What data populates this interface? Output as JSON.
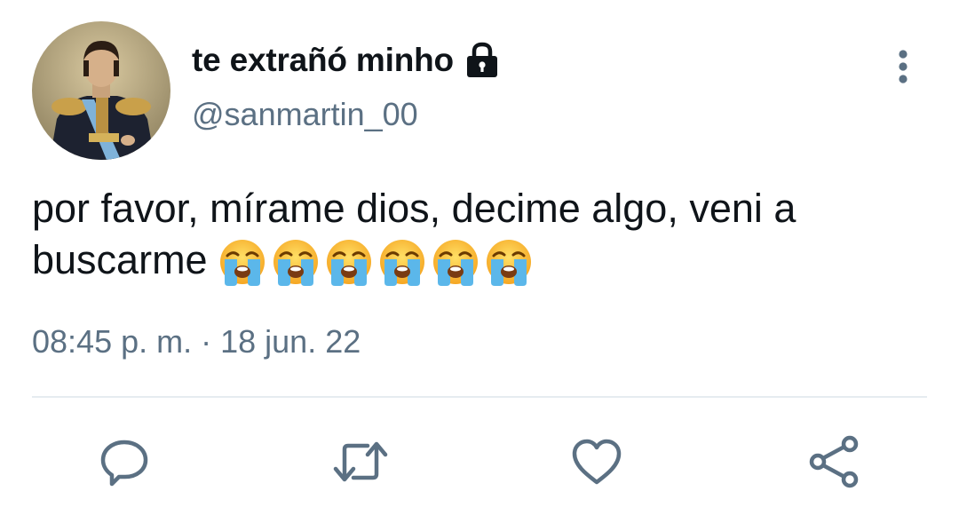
{
  "tweet": {
    "display_name": "te extrañó minho",
    "handle": "@sanmartin_00",
    "text": "por favor, mírame dios, decime algo, veni a buscarme",
    "emoji": [
      "loudly-crying-face",
      "loudly-crying-face",
      "loudly-crying-face",
      "loudly-crying-face",
      "loudly-crying-face",
      "loudly-crying-face"
    ],
    "time": "08:45 p. m.",
    "separator": " · ",
    "date": "18 jun. 22"
  },
  "icons": {
    "protected": "lock-icon",
    "more": "more-vertical-icon",
    "reply": "reply-icon",
    "retweet": "retweet-icon",
    "like": "like-icon",
    "share": "share-icon"
  },
  "colors": {
    "text": "#0f1419",
    "secondary": "#5b7083",
    "divider": "#e6ecf0"
  }
}
